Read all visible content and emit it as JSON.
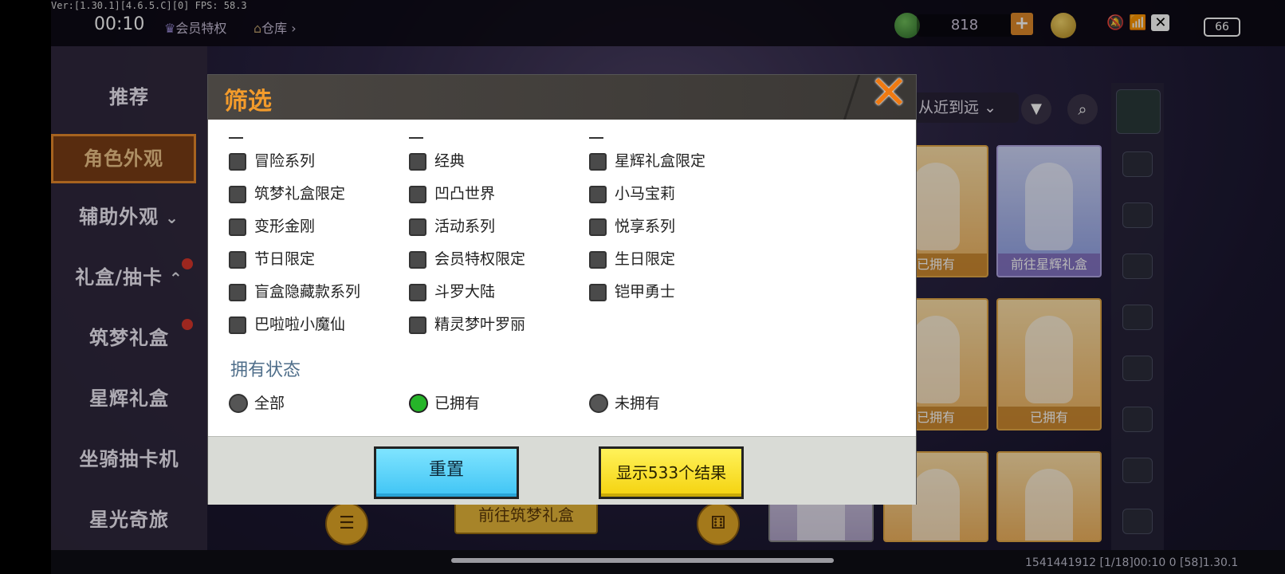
{
  "debug": {
    "version": "Ver:[1.30.1][4.6.5.C][0] FPS: 58.3"
  },
  "status_bar": {
    "time": "00:10",
    "battery": "66"
  },
  "top_bar": {
    "vip_label": "会员特权",
    "store_label": "仓库",
    "currency_amount": "818"
  },
  "left_nav": {
    "items": [
      {
        "label": "推荐"
      },
      {
        "label": "角色外观"
      },
      {
        "label": "辅助外观"
      },
      {
        "label": "礼盒/抽卡"
      },
      {
        "label": "筑梦礼盒"
      },
      {
        "label": "星辉礼盒"
      },
      {
        "label": "坐骑抽卡机"
      },
      {
        "label": "星光奇旅"
      }
    ]
  },
  "right_panel": {
    "sort_label": "从近到远",
    "cards": [
      {
        "caption": "已拥有"
      },
      {
        "caption": "前往星辉礼盒"
      },
      {
        "caption": "已拥有"
      },
      {
        "caption": "已拥有"
      }
    ],
    "bottom_button": "前往筑梦礼盒"
  },
  "filter_modal": {
    "title": "筛选",
    "series_options": [
      {
        "label": "冒险系列",
        "checked": false
      },
      {
        "label": "经典",
        "checked": false
      },
      {
        "label": "星辉礼盒限定",
        "checked": false
      },
      {
        "label": "筑梦礼盒限定",
        "checked": false
      },
      {
        "label": "凹凸世界",
        "checked": false
      },
      {
        "label": "小马宝莉",
        "checked": false
      },
      {
        "label": "变形金刚",
        "checked": false
      },
      {
        "label": "活动系列",
        "checked": false
      },
      {
        "label": "悦享系列",
        "checked": false
      },
      {
        "label": "节日限定",
        "checked": false
      },
      {
        "label": "会员特权限定",
        "checked": false
      },
      {
        "label": "生日限定",
        "checked": false
      },
      {
        "label": "盲盒隐藏款系列",
        "checked": false
      },
      {
        "label": "斗罗大陆",
        "checked": false
      },
      {
        "label": "铠甲勇士",
        "checked": false
      },
      {
        "label": "巴啦啦小魔仙",
        "checked": false
      },
      {
        "label": "精灵梦叶罗丽",
        "checked": false
      }
    ],
    "ownership": {
      "heading": "拥有状态",
      "options": [
        {
          "label": "全部",
          "selected": false
        },
        {
          "label": "已拥有",
          "selected": true
        },
        {
          "label": "未拥有",
          "selected": false
        }
      ]
    },
    "reset_label": "重置",
    "show_results_label": "显示533个结果"
  },
  "bottom_info": "1541441912    [1/18]00:10 0  [58]1.30.1"
}
